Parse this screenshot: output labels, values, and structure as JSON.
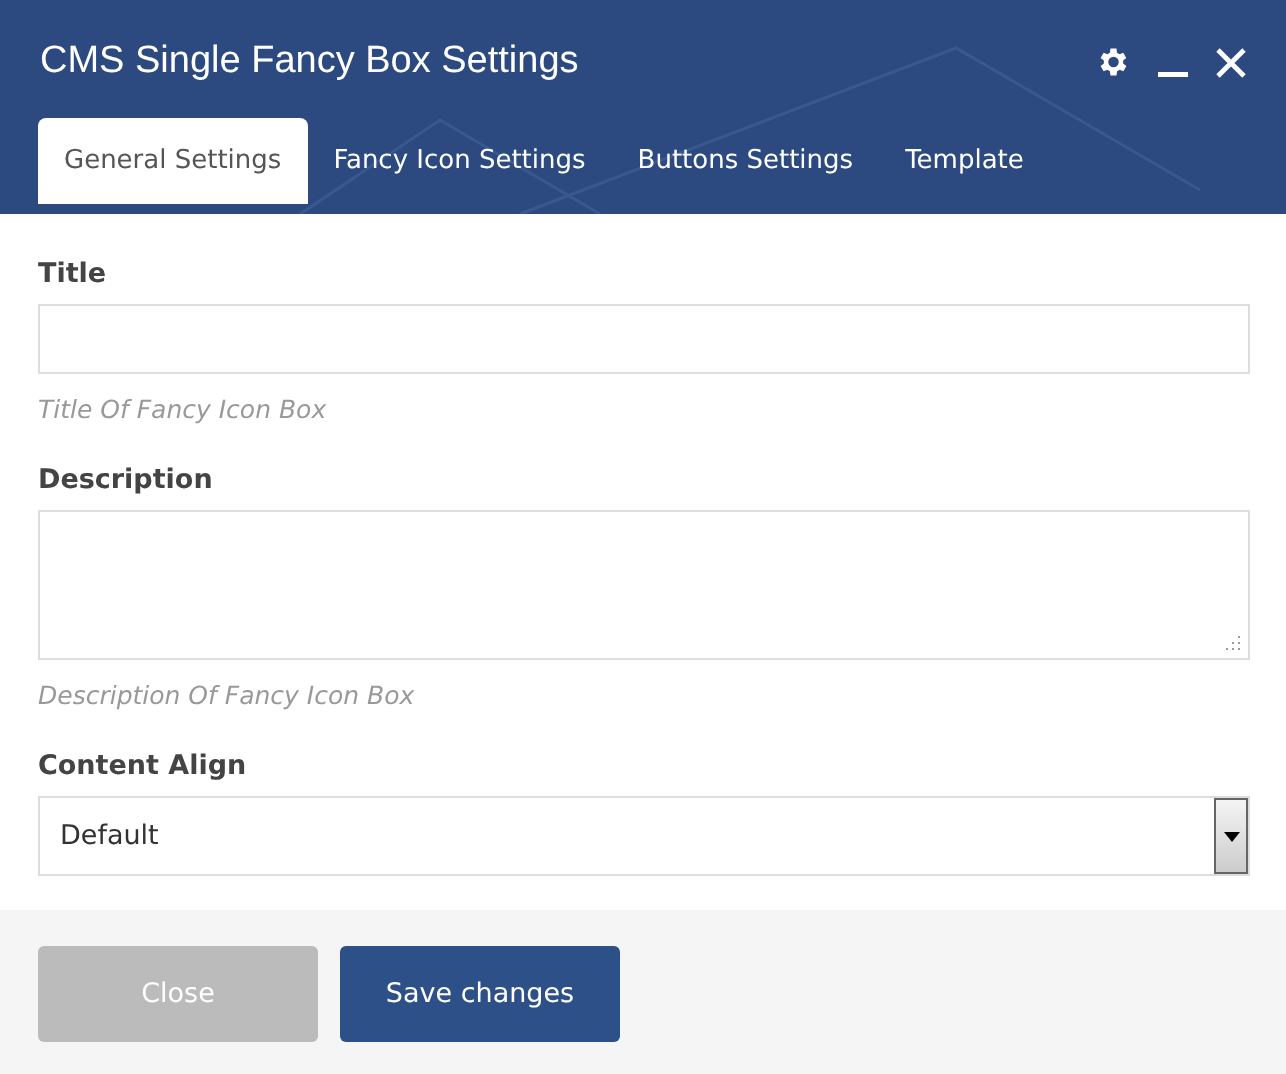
{
  "window": {
    "title": "CMS Single Fancy Box Settings"
  },
  "tabs": [
    {
      "label": "General Settings",
      "selected": true
    },
    {
      "label": "Fancy Icon Settings",
      "selected": false
    },
    {
      "label": "Buttons Settings",
      "selected": false
    },
    {
      "label": "Template",
      "selected": false
    }
  ],
  "fields": [
    {
      "kind": "text",
      "label": "Title",
      "hint": "Title Of Fancy Icon Box"
    },
    {
      "kind": "textarea",
      "label": "Description",
      "hint": "Description Of Fancy Icon Box"
    },
    {
      "kind": "select",
      "label": "Content Align",
      "value": "Default"
    }
  ],
  "buttons": [
    {
      "kind": "secondary",
      "label": "Close"
    },
    {
      "kind": "primary",
      "label": "Save changes"
    }
  ]
}
